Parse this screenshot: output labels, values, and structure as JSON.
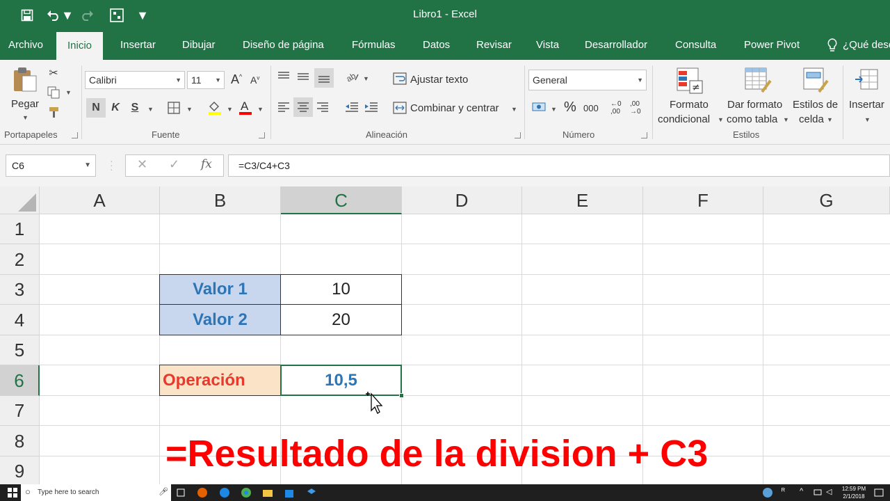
{
  "titlebar": {
    "title": "Libro1  -  Excel"
  },
  "tabs": [
    "Archivo",
    "Inicio",
    "Insertar",
    "Dibujar",
    "Diseño de página",
    "Fórmulas",
    "Datos",
    "Revisar",
    "Vista",
    "Desarrollador",
    "Consulta",
    "Power Pivot",
    "¿Qué dese"
  ],
  "ribbon": {
    "clipboard": {
      "paste": "Pegar",
      "group": "Portapapeles"
    },
    "font": {
      "name": "Calibri",
      "size": "11",
      "bold": "N",
      "italic": "K",
      "underline": "S",
      "group": "Fuente"
    },
    "alignment": {
      "wrap": "Ajustar texto",
      "merge": "Combinar y centrar",
      "group": "Alineación"
    },
    "number": {
      "format": "General",
      "percent": "%",
      "thousands": "000",
      "group": "Número"
    },
    "styles": {
      "conditional_1": "Formato",
      "conditional_2": "condicional",
      "table_1": "Dar formato",
      "table_2": "como tabla",
      "cell_1": "Estilos de",
      "cell_2": "celda",
      "group": "Estilos"
    },
    "cells": {
      "insert": "Insertar"
    }
  },
  "formula_bar": {
    "name_box": "C6",
    "formula": "=C3/C4+C3",
    "fx": "fx"
  },
  "grid": {
    "columns": [
      "A",
      "B",
      "C",
      "D",
      "E",
      "F",
      "G"
    ],
    "rows": [
      "1",
      "2",
      "3",
      "4",
      "5",
      "6",
      "7",
      "8",
      "9"
    ],
    "cells": {
      "B3": "Valor 1",
      "C3": "10",
      "B4": "Valor 2",
      "C4": "20",
      "B6": "Operación",
      "C6": "10,5"
    },
    "overlay_text": "=Resultado de la division + C3"
  },
  "colors": {
    "excel_green": "#217346",
    "label_fill": "#c9d7ee",
    "label_text": "#2e75b6",
    "operation_fill": "#fbe3c8",
    "operation_text": "#e8392c",
    "overlay_text": "#ff0000"
  },
  "taskbar": {
    "search_placeholder": "Type here to search",
    "time": "12:59 PM",
    "date": "2/1/2018"
  }
}
